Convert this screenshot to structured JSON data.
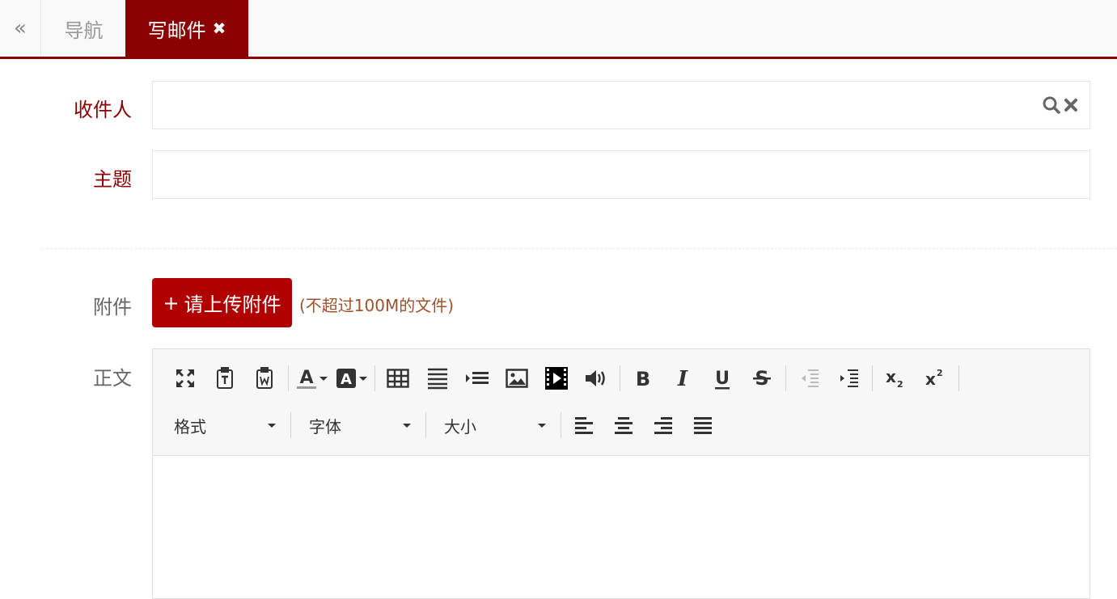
{
  "tabbar": {
    "collapse_glyph": "«",
    "tabs": [
      {
        "label": "导航",
        "active": false
      },
      {
        "label": "写邮件",
        "active": true,
        "close_icon": "close-icon"
      }
    ]
  },
  "form": {
    "recipient": {
      "label": "收件人",
      "value": "",
      "icons": [
        "search-icon",
        "clear-icon"
      ]
    },
    "subject": {
      "label": "主题",
      "value": ""
    },
    "attachment": {
      "label": "附件",
      "button_label": "请上传附件",
      "button_icon": "+",
      "hint": "(不超过100M的文件)"
    },
    "body": {
      "label": "正文"
    }
  },
  "editor": {
    "toolbar_row1": [
      "fullscreen-icon",
      "paste-text-icon",
      "paste-word-icon",
      "font-color-icon",
      "background-color-icon",
      "table-icon",
      "horizontal-rule-icon",
      "indent-list-icon",
      "image-icon",
      "video-icon",
      "audio-icon",
      "bold-icon",
      "italic-icon",
      "underline-icon",
      "strikethrough-icon",
      "outdent-icon",
      "indent-icon",
      "subscript-icon",
      "superscript-icon"
    ],
    "toolbar_row2": {
      "format_label": "格式",
      "font_label": "字体",
      "size_label": "大小",
      "align_icons": [
        "align-left-icon",
        "align-center-icon",
        "align-right-icon",
        "align-justify-icon"
      ]
    }
  },
  "colors": {
    "brand": "#8b0000",
    "button": "#b00000",
    "hint": "#a0522d"
  }
}
